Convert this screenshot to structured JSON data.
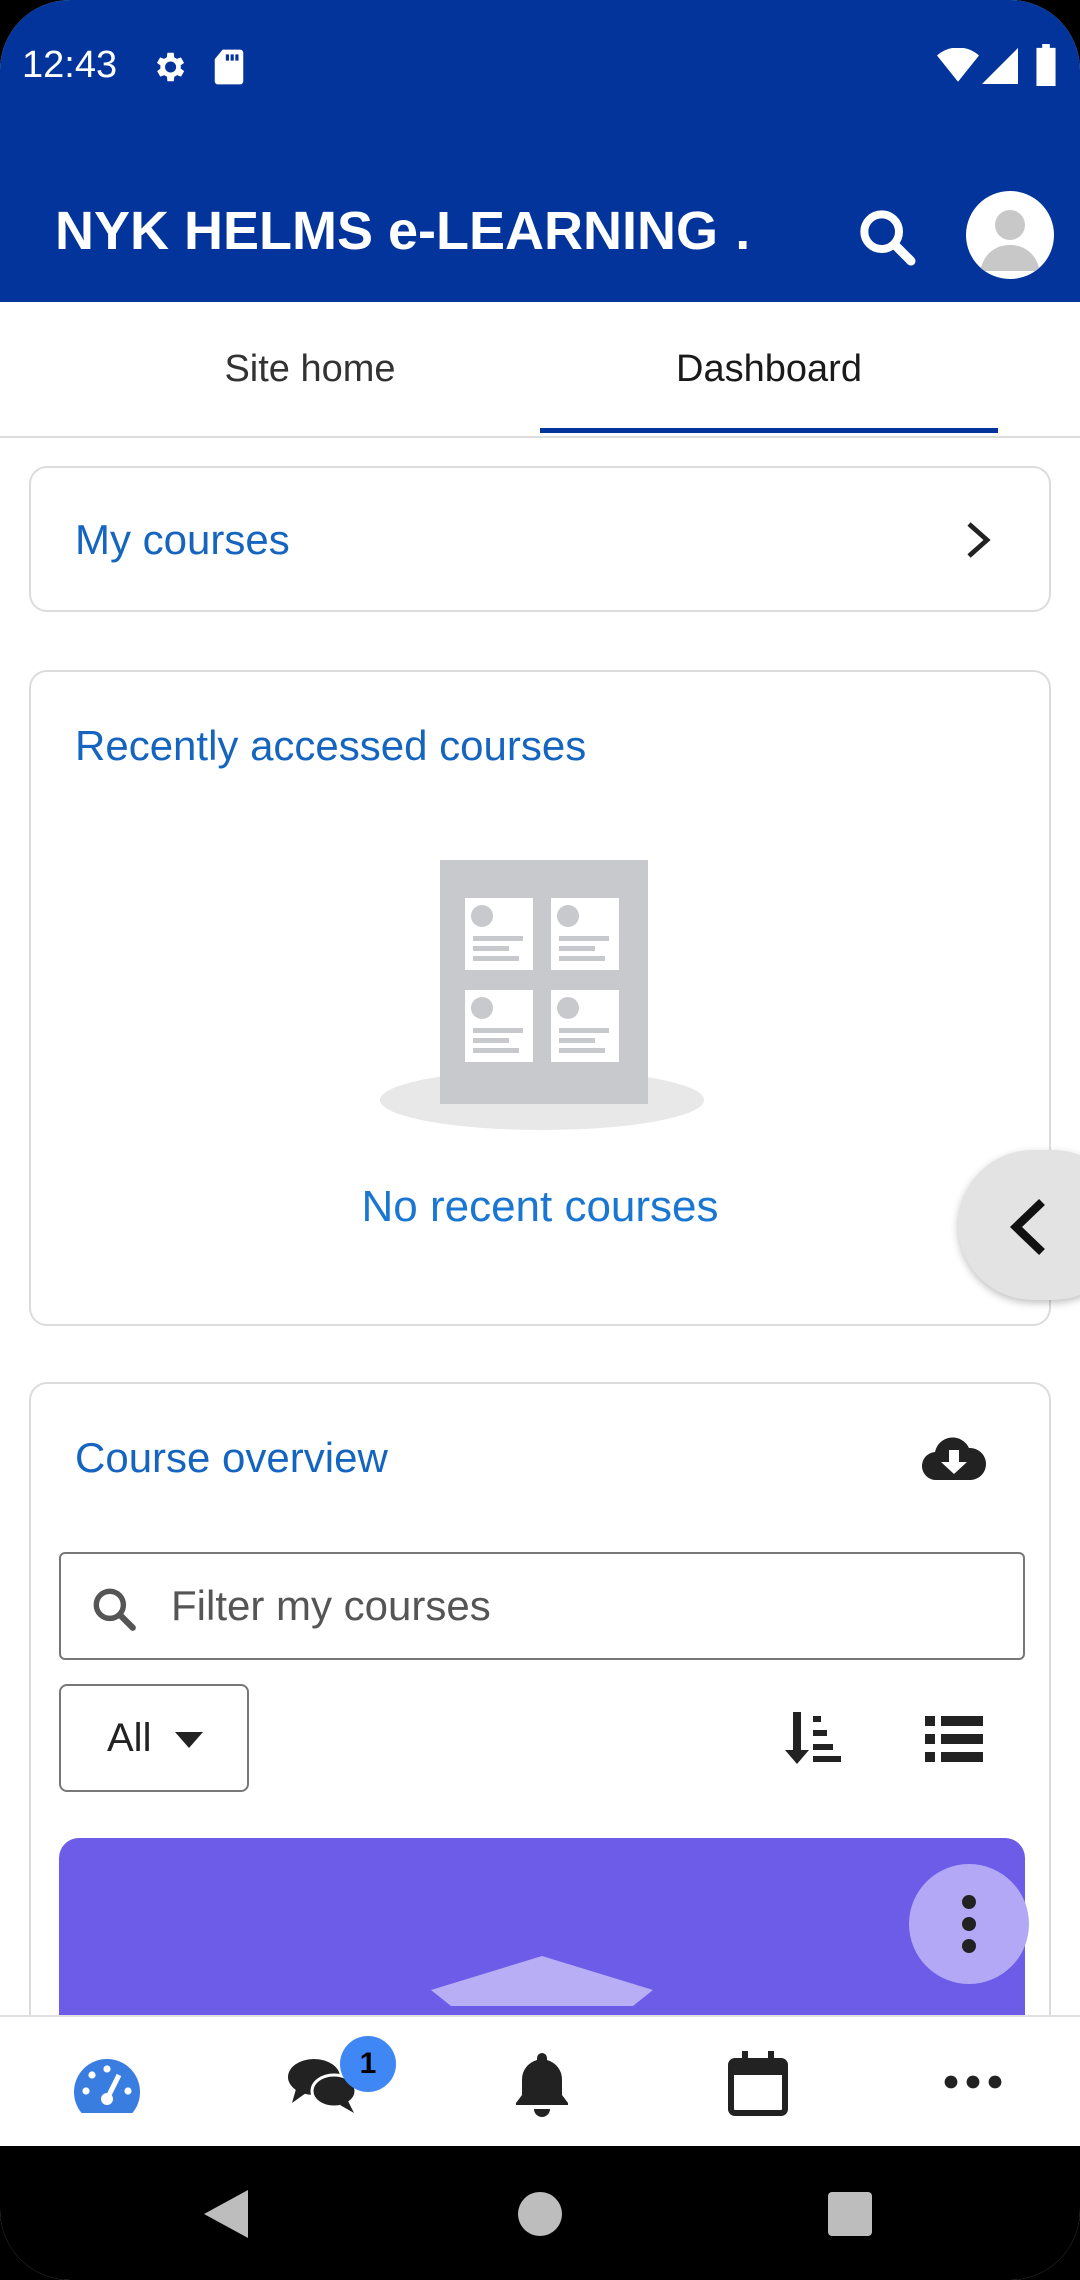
{
  "status_bar": {
    "time": "12:43",
    "icons": [
      "settings-icon",
      "sd-card-icon",
      "wifi-icon",
      "signal-icon",
      "battery-icon"
    ]
  },
  "app_bar": {
    "title": "NYK HELMS e-LEARNING …",
    "background": "#02349c"
  },
  "tabs": [
    {
      "label": "Site home",
      "selected": false
    },
    {
      "label": "Dashboard",
      "selected": true
    }
  ],
  "my_courses": {
    "title": "My courses"
  },
  "recent": {
    "title": "Recently accessed courses",
    "empty_text": "No recent courses"
  },
  "overview": {
    "title": "Course overview",
    "filter_placeholder": "Filter my courses",
    "filter_select": "All",
    "tile_color": "#6c5ce7"
  },
  "bottom_nav": {
    "items": [
      "dashboard-icon",
      "messages-icon",
      "notifications-icon",
      "calendar-icon",
      "more-icon"
    ],
    "messages_badge": "1"
  },
  "colors": {
    "accent": "#1565c0",
    "brand": "#02349c"
  }
}
